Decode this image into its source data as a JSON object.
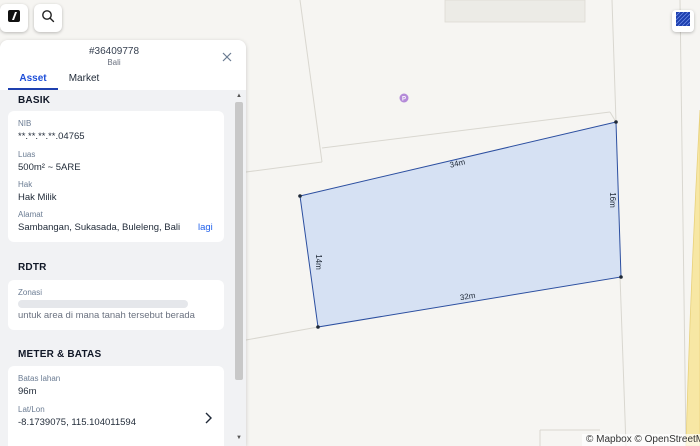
{
  "map": {
    "dimensions": {
      "top": "34m",
      "right": "16m",
      "bottom": "32m",
      "left": "14m"
    },
    "poi_icon": "parking-pin-icon",
    "parcel_fill": "#d6e1f3",
    "parcel_stroke": "#2c4fa0",
    "attribution": "© Mapbox © OpenStreetMap",
    "mapbox_logo": "mapbox"
  },
  "toolbar": {
    "logo_icon": "brand-logo-icon",
    "search_icon": "search-icon",
    "layer_icon": "layer-icon"
  },
  "panel": {
    "parcel_id": "#36409778",
    "region": "Bali",
    "tabs": [
      {
        "label": "Asset",
        "active": true
      },
      {
        "label": "Market",
        "active": false
      }
    ],
    "basik": {
      "title": "BASIK",
      "nib_label": "NIB",
      "nib_value": "**.**.**.**.04765",
      "luas_label": "Luas",
      "luas_value": "500m² ~ 5ARE",
      "hak_label": "Hak",
      "hak_value": "Hak Milik",
      "alamat_label": "Alamat",
      "alamat_value": "Sambangan, Sukasada, Buleleng, Bali",
      "more_label": "lagi"
    },
    "rdtr": {
      "title": "RDTR",
      "zonasi_label": "Zonasi",
      "zonasi_hint": "untuk area di mana tanah tersebut berada"
    },
    "meter": {
      "title": "METER & BATAS",
      "batas_label": "Batas lahan",
      "batas_value": "96m",
      "latlon_label": "Lat/Lon",
      "latlon_value": "-8.1739075, 115.104011594"
    }
  }
}
